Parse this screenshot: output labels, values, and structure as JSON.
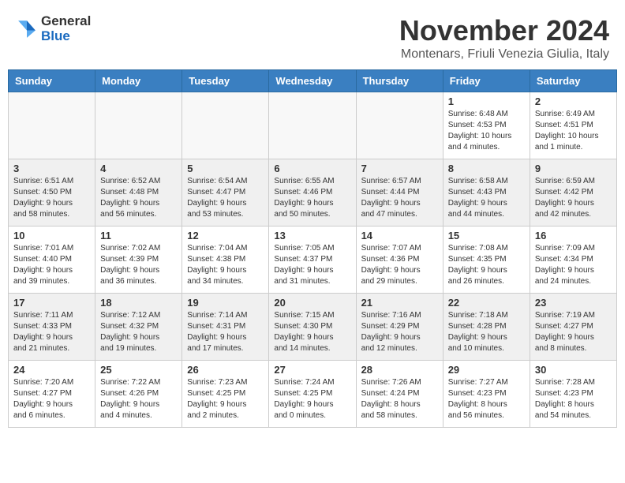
{
  "header": {
    "logo": {
      "general": "General",
      "blue": "Blue"
    },
    "title": "November 2024",
    "subtitle": "Montenars, Friuli Venezia Giulia, Italy"
  },
  "calendar": {
    "days_of_week": [
      "Sunday",
      "Monday",
      "Tuesday",
      "Wednesday",
      "Thursday",
      "Friday",
      "Saturday"
    ],
    "weeks": [
      [
        {
          "day": "",
          "empty": true
        },
        {
          "day": "",
          "empty": true
        },
        {
          "day": "",
          "empty": true
        },
        {
          "day": "",
          "empty": true
        },
        {
          "day": "",
          "empty": true
        },
        {
          "day": "1",
          "info": "Sunrise: 6:48 AM\nSunset: 4:53 PM\nDaylight: 10 hours\nand 4 minutes."
        },
        {
          "day": "2",
          "info": "Sunrise: 6:49 AM\nSunset: 4:51 PM\nDaylight: 10 hours\nand 1 minute."
        }
      ],
      [
        {
          "day": "3",
          "info": "Sunrise: 6:51 AM\nSunset: 4:50 PM\nDaylight: 9 hours\nand 58 minutes."
        },
        {
          "day": "4",
          "info": "Sunrise: 6:52 AM\nSunset: 4:48 PM\nDaylight: 9 hours\nand 56 minutes."
        },
        {
          "day": "5",
          "info": "Sunrise: 6:54 AM\nSunset: 4:47 PM\nDaylight: 9 hours\nand 53 minutes."
        },
        {
          "day": "6",
          "info": "Sunrise: 6:55 AM\nSunset: 4:46 PM\nDaylight: 9 hours\nand 50 minutes."
        },
        {
          "day": "7",
          "info": "Sunrise: 6:57 AM\nSunset: 4:44 PM\nDaylight: 9 hours\nand 47 minutes."
        },
        {
          "day": "8",
          "info": "Sunrise: 6:58 AM\nSunset: 4:43 PM\nDaylight: 9 hours\nand 44 minutes."
        },
        {
          "day": "9",
          "info": "Sunrise: 6:59 AM\nSunset: 4:42 PM\nDaylight: 9 hours\nand 42 minutes."
        }
      ],
      [
        {
          "day": "10",
          "info": "Sunrise: 7:01 AM\nSunset: 4:40 PM\nDaylight: 9 hours\nand 39 minutes."
        },
        {
          "day": "11",
          "info": "Sunrise: 7:02 AM\nSunset: 4:39 PM\nDaylight: 9 hours\nand 36 minutes."
        },
        {
          "day": "12",
          "info": "Sunrise: 7:04 AM\nSunset: 4:38 PM\nDaylight: 9 hours\nand 34 minutes."
        },
        {
          "day": "13",
          "info": "Sunrise: 7:05 AM\nSunset: 4:37 PM\nDaylight: 9 hours\nand 31 minutes."
        },
        {
          "day": "14",
          "info": "Sunrise: 7:07 AM\nSunset: 4:36 PM\nDaylight: 9 hours\nand 29 minutes."
        },
        {
          "day": "15",
          "info": "Sunrise: 7:08 AM\nSunset: 4:35 PM\nDaylight: 9 hours\nand 26 minutes."
        },
        {
          "day": "16",
          "info": "Sunrise: 7:09 AM\nSunset: 4:34 PM\nDaylight: 9 hours\nand 24 minutes."
        }
      ],
      [
        {
          "day": "17",
          "info": "Sunrise: 7:11 AM\nSunset: 4:33 PM\nDaylight: 9 hours\nand 21 minutes."
        },
        {
          "day": "18",
          "info": "Sunrise: 7:12 AM\nSunset: 4:32 PM\nDaylight: 9 hours\nand 19 minutes."
        },
        {
          "day": "19",
          "info": "Sunrise: 7:14 AM\nSunset: 4:31 PM\nDaylight: 9 hours\nand 17 minutes."
        },
        {
          "day": "20",
          "info": "Sunrise: 7:15 AM\nSunset: 4:30 PM\nDaylight: 9 hours\nand 14 minutes."
        },
        {
          "day": "21",
          "info": "Sunrise: 7:16 AM\nSunset: 4:29 PM\nDaylight: 9 hours\nand 12 minutes."
        },
        {
          "day": "22",
          "info": "Sunrise: 7:18 AM\nSunset: 4:28 PM\nDaylight: 9 hours\nand 10 minutes."
        },
        {
          "day": "23",
          "info": "Sunrise: 7:19 AM\nSunset: 4:27 PM\nDaylight: 9 hours\nand 8 minutes."
        }
      ],
      [
        {
          "day": "24",
          "info": "Sunrise: 7:20 AM\nSunset: 4:27 PM\nDaylight: 9 hours\nand 6 minutes."
        },
        {
          "day": "25",
          "info": "Sunrise: 7:22 AM\nSunset: 4:26 PM\nDaylight: 9 hours\nand 4 minutes."
        },
        {
          "day": "26",
          "info": "Sunrise: 7:23 AM\nSunset: 4:25 PM\nDaylight: 9 hours\nand 2 minutes."
        },
        {
          "day": "27",
          "info": "Sunrise: 7:24 AM\nSunset: 4:25 PM\nDaylight: 9 hours\nand 0 minutes."
        },
        {
          "day": "28",
          "info": "Sunrise: 7:26 AM\nSunset: 4:24 PM\nDaylight: 8 hours\nand 58 minutes."
        },
        {
          "day": "29",
          "info": "Sunrise: 7:27 AM\nSunset: 4:23 PM\nDaylight: 8 hours\nand 56 minutes."
        },
        {
          "day": "30",
          "info": "Sunrise: 7:28 AM\nSunset: 4:23 PM\nDaylight: 8 hours\nand 54 minutes."
        }
      ]
    ]
  }
}
